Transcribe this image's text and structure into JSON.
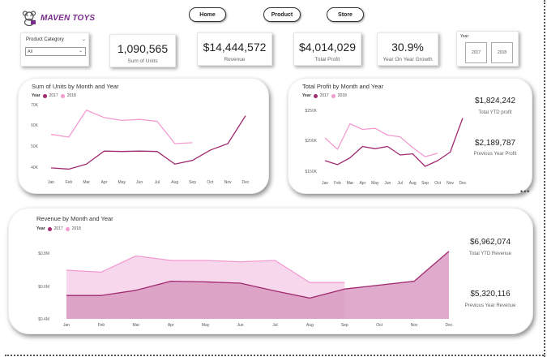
{
  "brand": {
    "name": "MAVEN TOYS"
  },
  "nav": [
    {
      "label": "Home"
    },
    {
      "label": "Product"
    },
    {
      "label": "Store"
    }
  ],
  "filter": {
    "title": "Product Category",
    "value": "All"
  },
  "kpis": [
    {
      "value": "1,090,565",
      "label": "Sum of Units"
    },
    {
      "value": "$14,444,572",
      "label": "Revenue"
    },
    {
      "value": "$4,014,029",
      "label": "Total Profit"
    },
    {
      "value": "30.9%",
      "label": "Year On Year Growth"
    }
  ],
  "year_slicer": {
    "title": "Year",
    "options": [
      "2017",
      "2018"
    ]
  },
  "legend": {
    "title": "Year",
    "y2017": "2017",
    "y2018": "2018"
  },
  "colors": {
    "y2017": "#a0296f",
    "y2018": "#f29bd1",
    "area2017": "#d99bc2",
    "area2018": "#f6d3ea"
  },
  "profit_side": {
    "ytd_value": "$1,824,242",
    "ytd_label": "Total YTD profit",
    "prev_value": "$2,189,787",
    "prev_label": "Previous Year Profit"
  },
  "revenue_side": {
    "ytd_value": "$6,962,074",
    "ytd_label": "Total YTD Revenue",
    "prev_value": "$5,320,116",
    "prev_label": "Previous Year Revenue"
  },
  "chart_data": [
    {
      "type": "line",
      "title": "Sum of Units by Month and Year",
      "categories": [
        "Jan",
        "Feb",
        "Mar",
        "Apr",
        "May",
        "Jun",
        "Jul",
        "Aug",
        "Sep",
        "Oct",
        "Nov",
        "Dec"
      ],
      "yticks": [
        "70K",
        "60K",
        "50K",
        "40K"
      ],
      "ylim": [
        38000,
        72000
      ],
      "series": [
        {
          "name": "2017",
          "values": [
            38500,
            37800,
            40500,
            47500,
            47300,
            47500,
            47300,
            40500,
            42500,
            48000,
            51500,
            66500
          ]
        },
        {
          "name": "2018",
          "values": [
            56500,
            55000,
            69500,
            65500,
            64000,
            64500,
            63500,
            51500,
            52000
          ]
        }
      ]
    },
    {
      "type": "line",
      "title": "Total Profit by Month and Year",
      "categories": [
        "Jan",
        "Feb",
        "Mar",
        "Apr",
        "May",
        "Jun",
        "Jul",
        "Aug",
        "Sep",
        "Oct",
        "Nov",
        "Dec"
      ],
      "yticks": [
        "$250K",
        "$200K",
        "$150K"
      ],
      "ylim": [
        145000,
        255000
      ],
      "series": [
        {
          "name": "2017",
          "values": [
            165000,
            158000,
            170000,
            190000,
            186000,
            190000,
            175000,
            177000,
            155000,
            165000,
            180000,
            240000
          ]
        },
        {
          "name": "2018",
          "values": [
            205000,
            185000,
            230000,
            220000,
            222000,
            210000,
            207000,
            188000,
            172000,
            178000
          ]
        }
      ]
    },
    {
      "type": "area",
      "title": "Revenue by Month and Year",
      "categories": [
        "Jan",
        "Feb",
        "Mar",
        "Apr",
        "May",
        "Jun",
        "Jul",
        "Aug",
        "Sep",
        "Oct",
        "Nov",
        "Dec"
      ],
      "yticks": [
        "$0.8M",
        "$0.6M",
        "$0.4M"
      ],
      "ylim": [
        0.4,
        1.0
      ],
      "series": [
        {
          "name": "2017",
          "values": [
            0.58,
            0.58,
            0.62,
            0.69,
            0.685,
            0.675,
            0.615,
            0.56,
            0.63,
            0.66,
            0.69,
            0.92
          ]
        },
        {
          "name": "2018",
          "values": [
            0.775,
            0.76,
            0.885,
            0.85,
            0.85,
            0.84,
            0.85,
            0.68,
            0.68
          ]
        }
      ]
    }
  ]
}
